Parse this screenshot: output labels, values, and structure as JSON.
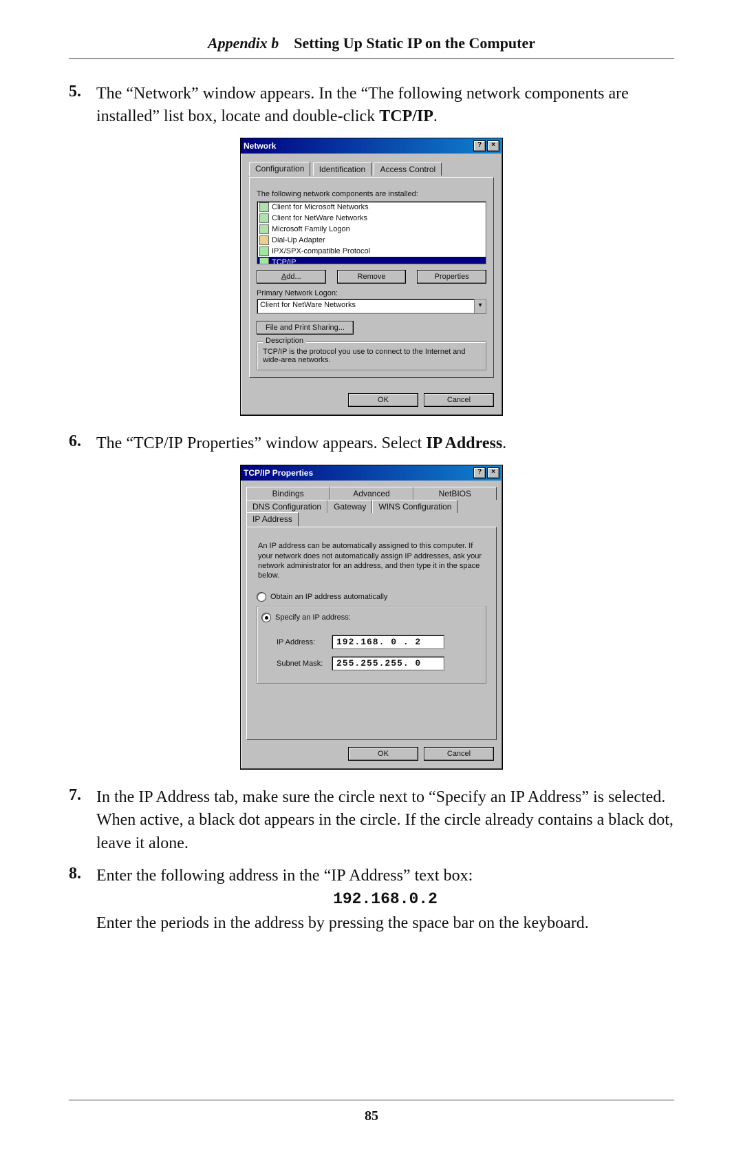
{
  "header": {
    "appendix": "Appendix b",
    "title": "Setting Up Static IP on the Computer"
  },
  "steps": {
    "s5": {
      "num": "5.",
      "text_a": "The “Network” window appears. In the “The following network components are installed” list box, locate and double-click ",
      "bold": "TCP/IP",
      "text_b": "."
    },
    "s6": {
      "num": "6.",
      "text_a": "The “",
      "sc1": "TCP/IP",
      "text_b": " Properties” window appears. Select ",
      "bold": "IP Address",
      "text_c": "."
    },
    "s7": {
      "num": "7.",
      "text": "In the IP Address tab, make sure the circle next to “Specify an IP Address” is selected. When active, a black dot appears in the circle. If the circle already contains a black dot, leave it alone."
    },
    "s8": {
      "num": "8.",
      "text_a": "Enter the following address in the “",
      "sc1": "IP",
      "text_b": " Address” text box:",
      "code": "192.168.0.2",
      "text_c": "Enter the periods in the address by pressing the space bar on the keyboard."
    }
  },
  "network_dialog": {
    "title": "Network",
    "help_btn": "?",
    "close_btn": "×",
    "tabs": [
      "Configuration",
      "Identification",
      "Access Control"
    ],
    "list_heading": "The following network components are installed:",
    "items": [
      "Client for Microsoft Networks",
      "Client for NetWare Networks",
      "Microsoft Family Logon",
      "Dial-Up Adapter",
      "IPX/SPX-compatible Protocol",
      "TCP/IP"
    ],
    "buttons": {
      "add": "Add...",
      "remove": "Remove",
      "properties": "Properties"
    },
    "primary_label": "Primary Network Logon:",
    "primary_value": "Client for NetWare Networks",
    "file_share": "File and Print Sharing...",
    "desc_legend": "Description",
    "desc_text": "TCP/IP is the protocol you use to connect to the Internet and wide-area networks.",
    "ok": "OK",
    "cancel": "Cancel"
  },
  "tcpip_dialog": {
    "title": "TCP/IP Properties",
    "help_btn": "?",
    "close_btn": "×",
    "tabs_row1": [
      "Bindings",
      "Advanced",
      "NetBIOS"
    ],
    "tabs_row2": [
      "DNS Configuration",
      "Gateway",
      "WINS Configuration",
      "IP Address"
    ],
    "help_text": "An IP address can be automatically assigned to this computer. If your network does not automatically assign IP addresses, ask your network administrator for an address, and then type it in the space below.",
    "radio_auto": "Obtain an IP address automatically",
    "radio_spec": "Specify an IP address:",
    "ip_label": "IP Address:",
    "ip_value": "192.168. 0 . 2",
    "mask_label": "Subnet Mask:",
    "mask_value": "255.255.255. 0",
    "ok": "OK",
    "cancel": "Cancel"
  },
  "page_number": "85"
}
